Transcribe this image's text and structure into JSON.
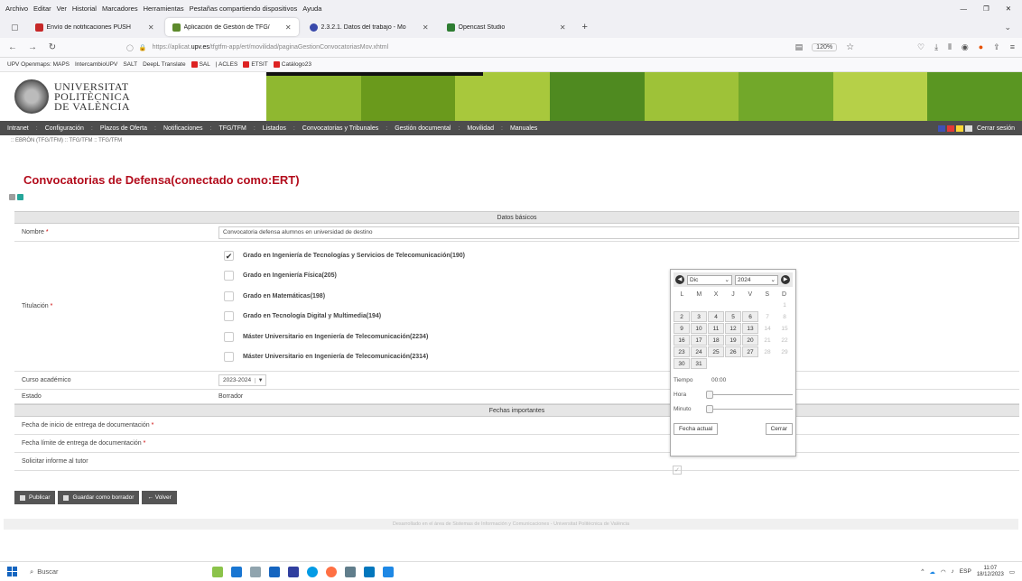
{
  "browser": {
    "menu": [
      "Archivo",
      "Editar",
      "Ver",
      "Historial",
      "Marcadores",
      "Herramientas",
      "Pestañas compartiendo dispositivos",
      "Ayuda"
    ],
    "tabs": [
      {
        "label": "Envío de notificaciones PUSH",
        "color": "#c62828"
      },
      {
        "label": "Aplicación de Gestión de TFG/",
        "color": "#5d8a2c"
      },
      {
        "label": "2.3.2.1. Datos del trabajo - Mo",
        "color": "#3949ab"
      },
      {
        "label": "Opencast Studio",
        "color": "#2e7d32"
      }
    ],
    "url_prefix": "https://aplicat.",
    "url_domain": "upv.es",
    "url_path": "/tfgtfm-app/ert/movilidad/paginaGestionConvocatoriasMov.xhtml",
    "zoom": "120%",
    "bookmarks": [
      "UPV Openmaps: MAPS",
      "IntercambioUPV",
      "SALT",
      "DeepL Translate",
      "SAL",
      "ACLES",
      "ETSIT",
      "Catálogo23"
    ]
  },
  "header": {
    "university_line1": "UNIVERSITAT",
    "university_line2": "POLITÈCNICA",
    "university_line3": "DE VALÈNCIA",
    "banner_colors": [
      "#8fb830",
      "#6a9a1c",
      "#a8c83c",
      "#4f8a20",
      "#9ec238",
      "#72a82a",
      "#b6d048",
      "#5a9622"
    ]
  },
  "mainmenu": {
    "items": [
      "Intranet",
      "Configuración",
      "Plazos de Oferta",
      "Notificaciones",
      "TFG/TFM",
      "Listados",
      "Convocatorias y Tribunales",
      "Gestión documental",
      "Movilidad",
      "Manuales"
    ],
    "logout": "Cerrar sesión"
  },
  "breadcrumb": ":: EBRÓN (TFG/TFM) :: TFG/TFM :: TFG/TFM",
  "page": {
    "title": "Convocatorias de Defensa(conectado como:ERT)"
  },
  "form": {
    "section_basic": "Datos básicos",
    "section_dates": "Fechas importantes",
    "nombre_label": "Nombre",
    "nombre_value": "Convocatoria defensa alumnos en universidad de destino",
    "titulacion_label": "Titulación",
    "titulaciones": [
      {
        "label": "Grado en Ingeniería de Tecnologías y Servicios de Telecomunicación(190)",
        "checked": true
      },
      {
        "label": "Grado en Ingeniería Física(205)",
        "checked": false
      },
      {
        "label": "Grado en Matemáticas(198)",
        "checked": false
      },
      {
        "label": "Grado en Tecnología Digital y Multimedia(194)",
        "checked": false
      },
      {
        "label": "Máster Universitario en Ingeniería de Telecomunicación(2234)",
        "checked": false
      },
      {
        "label": "Máster Universitario en Ingeniería de Telecomunicación(2314)",
        "checked": false
      }
    ],
    "curso_label": "Curso académico",
    "curso_value": "2023-2024",
    "estado_label": "Estado",
    "estado_value": "Borrador",
    "fecha_inicio_label": "Fecha de inicio de entrega de documentación",
    "fecha_limite_label": "Fecha límite de entrega de documentación",
    "informe_label": "Solicitar informe al tutor",
    "required_mark": "*"
  },
  "buttons": {
    "publicar": "Publicar",
    "guardar": "Guardar como borrador",
    "volver": "← Volver"
  },
  "footer": "Desarrollado en el área de Sistemas de Información y Comunicaciones - Universitat Politècnica de València",
  "datepicker": {
    "month": "Dic",
    "year": "2024",
    "weekdays": [
      "L",
      "M",
      "X",
      "J",
      "V",
      "S",
      "D"
    ],
    "weeks": [
      [
        "",
        "",
        "",
        "",
        "",
        "",
        "1"
      ],
      [
        "2",
        "3",
        "4",
        "5",
        "6",
        "7",
        "8"
      ],
      [
        "9",
        "10",
        "11",
        "12",
        "13",
        "14",
        "15"
      ],
      [
        "16",
        "17",
        "18",
        "19",
        "20",
        "21",
        "22"
      ],
      [
        "23",
        "24",
        "25",
        "26",
        "27",
        "28",
        "29"
      ],
      [
        "30",
        "31",
        "",
        "",
        "",
        "",
        ""
      ]
    ],
    "time_label": "Tiempo",
    "time_value": "00:00",
    "hour_label": "Hora",
    "minute_label": "Minuto",
    "now_button": "Fecha actual",
    "close_button": "Cerrar"
  },
  "taskbar": {
    "search": "Buscar",
    "lang": "ESP",
    "time": "11:07",
    "date": "18/12/2023"
  }
}
